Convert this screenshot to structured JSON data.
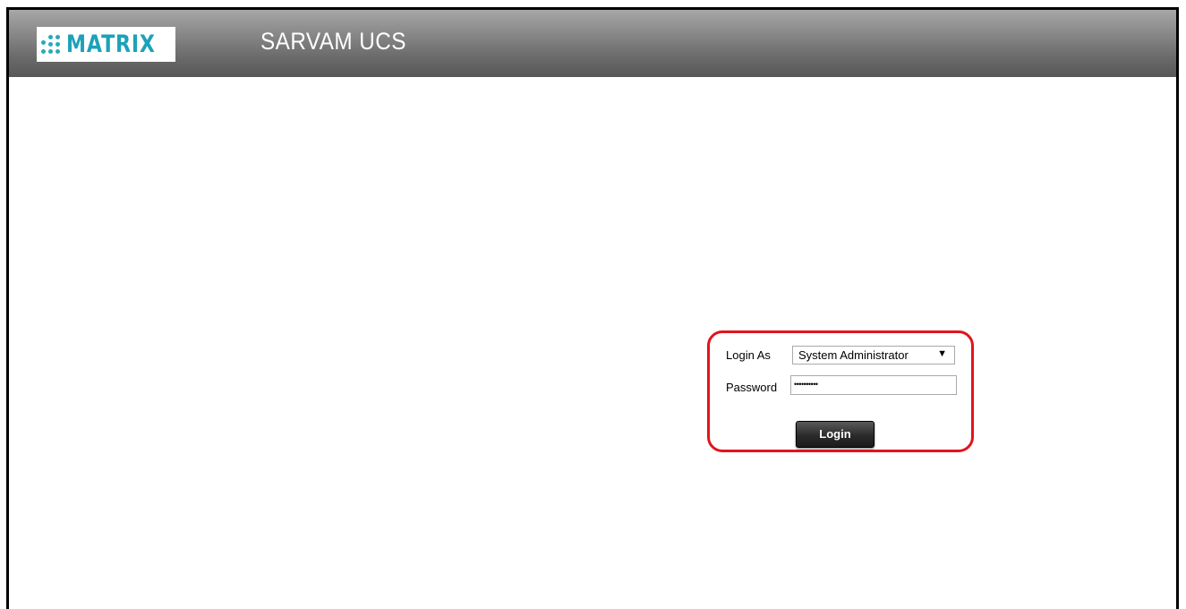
{
  "header": {
    "logo_text": "MATRIX",
    "app_title": "SARVAM UCS"
  },
  "login": {
    "login_as_label": "Login As",
    "login_as_value": "System Administrator",
    "password_label": "Password",
    "password_mask": "••••••••••",
    "login_button": "Login"
  },
  "colors": {
    "brand_teal": "#1ca2b9",
    "highlight_red": "#e2141c",
    "header_gray": "#7a7a7a"
  },
  "icons": {
    "logo_mark": "dot-cluster-icon",
    "dropdown": "chevron-down-icon"
  }
}
